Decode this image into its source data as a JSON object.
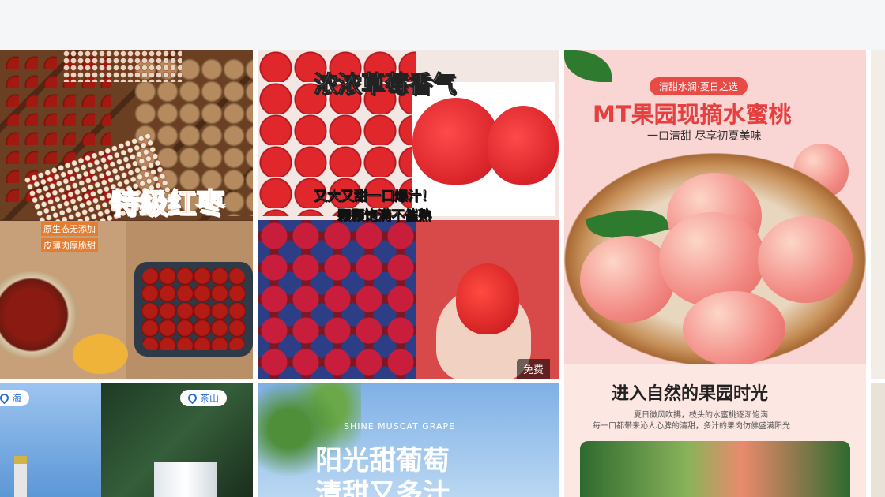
{
  "cards": {
    "dates": {
      "title": "特级红枣",
      "badge_line1": "原生态无添加",
      "badge_line2": "皮薄肉厚脆甜"
    },
    "strawberry": {
      "title": "浓浓草莓香气",
      "line1": "又大又甜一口爆汁！",
      "line2": "颗颗饱满不催熟",
      "free_badge": "免费"
    },
    "peach": {
      "pill": "清甜水润·夏日之选",
      "title": "MT果园现摘水蜜桃",
      "subtitle": "一口清甜 尽享初夏美味",
      "heading": "进入自然的果园时光",
      "desc_line1": "夏日微风吹拂，枝头的水蜜桃逐渐饱满",
      "desc_line2": "每一口都带来沁人心脾的清甜，多汁的果肉仿佛盛满阳光"
    },
    "travel": {
      "tag_left": "海",
      "tag_right": "茶山"
    },
    "grape": {
      "en": "SHINE MUSCAT GRAPE",
      "title_line1": "阳光甜葡萄",
      "title_line2": "清甜又多汁"
    }
  },
  "colors": {
    "accent_red": "#e63f3f",
    "tag_blue": "#2a6bd6",
    "topbar": "#f5f6f8"
  }
}
